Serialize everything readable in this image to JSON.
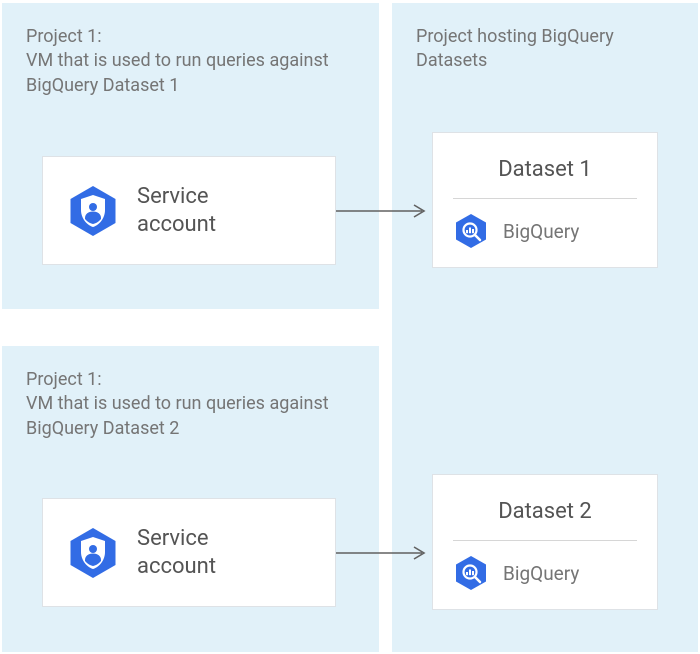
{
  "left_top": {
    "caption": "Project 1:\nVM that is used to run queries against BigQuery Dataset 1",
    "service_account_label": "Service\naccount"
  },
  "left_bottom": {
    "caption": "Project 1:\nVM that is used to run queries against BigQuery Dataset 2",
    "service_account_label": "Service\naccount"
  },
  "right": {
    "caption": "Project hosting BigQuery Datasets",
    "dataset1": {
      "title": "Dataset 1",
      "bq_label": "BigQuery"
    },
    "dataset2": {
      "title": "Dataset 2",
      "bq_label": "BigQuery"
    }
  }
}
